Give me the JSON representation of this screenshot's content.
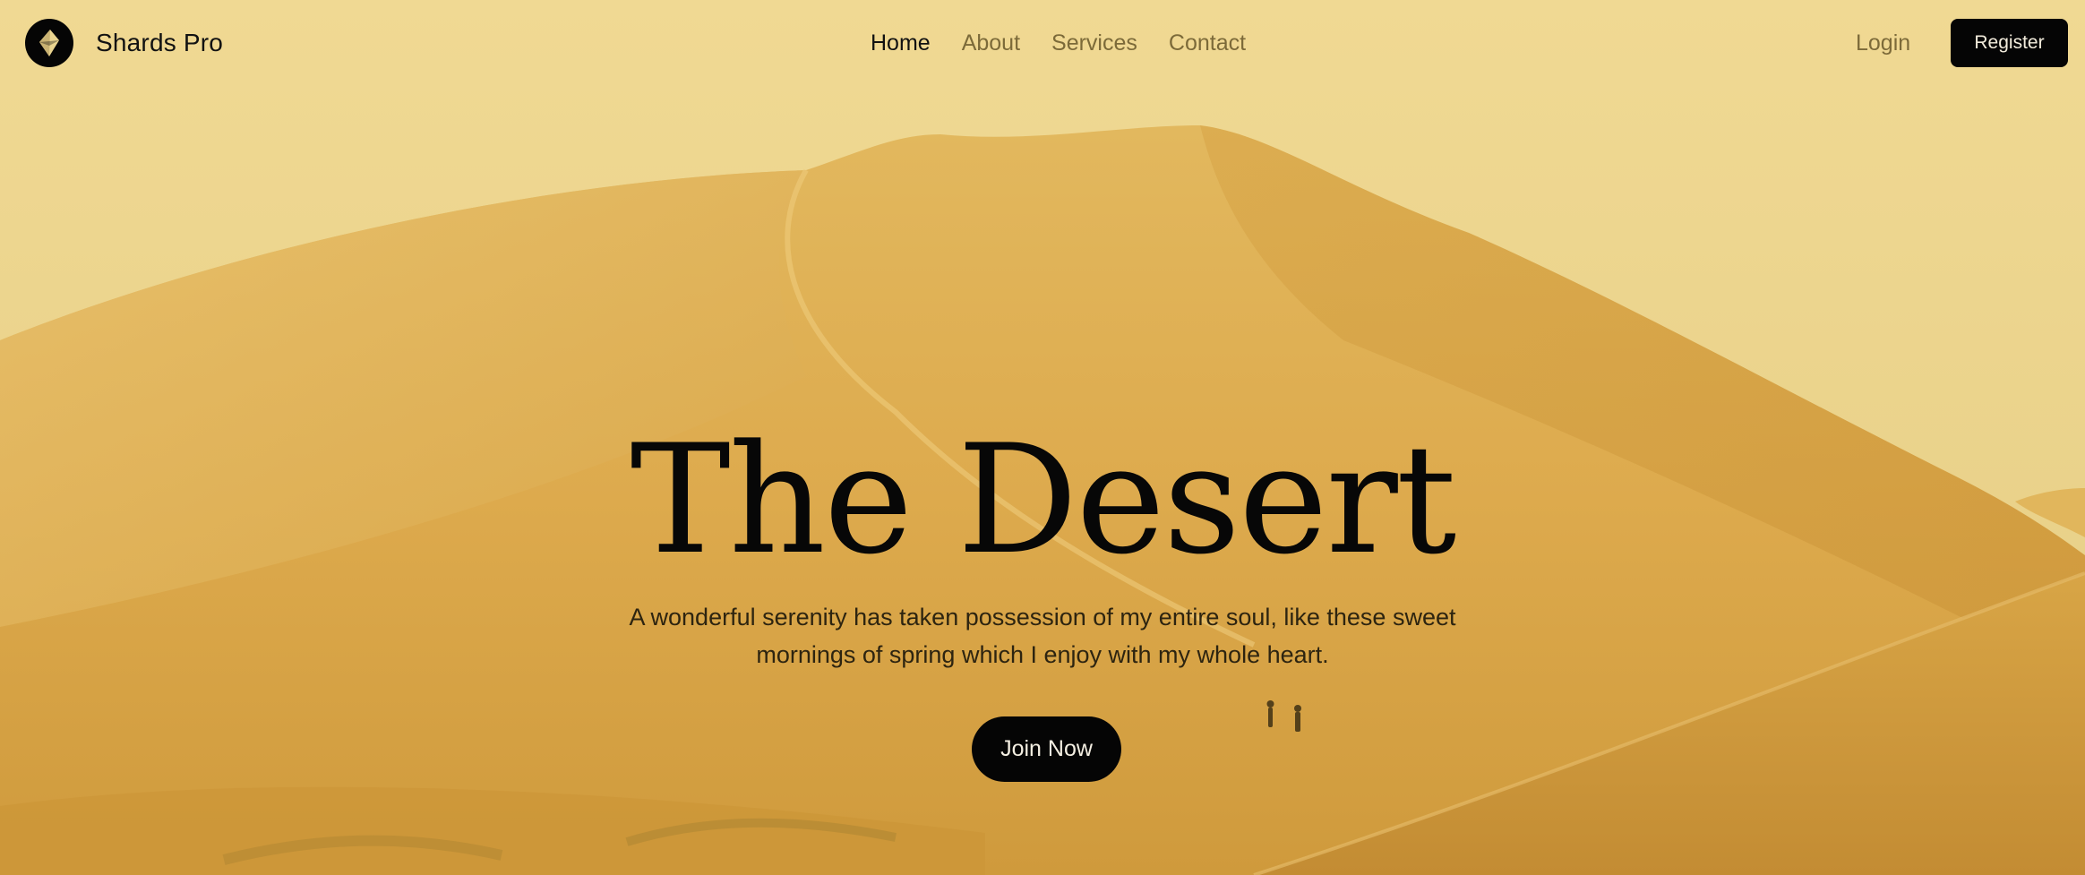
{
  "navbar": {
    "brand_name": "Shards Pro",
    "logo_icon": "diamond-shard-icon",
    "links": [
      {
        "label": "Home",
        "active": true
      },
      {
        "label": "About",
        "active": false
      },
      {
        "label": "Services",
        "active": false
      },
      {
        "label": "Contact",
        "active": false
      }
    ],
    "login_label": "Login",
    "register_label": "Register"
  },
  "hero": {
    "title": "The Desert",
    "subtitle": "A wonderful serenity has taken possession of my entire soul, like these sweet mornings of spring which I enjoy with my whole heart.",
    "cta_label": "Join Now",
    "background": "desert-dunes-image"
  },
  "colors": {
    "accent": "#050505",
    "sky": "#ead48f",
    "sand": "#dcaa4a",
    "nav_inactive": "#7c6a39"
  }
}
